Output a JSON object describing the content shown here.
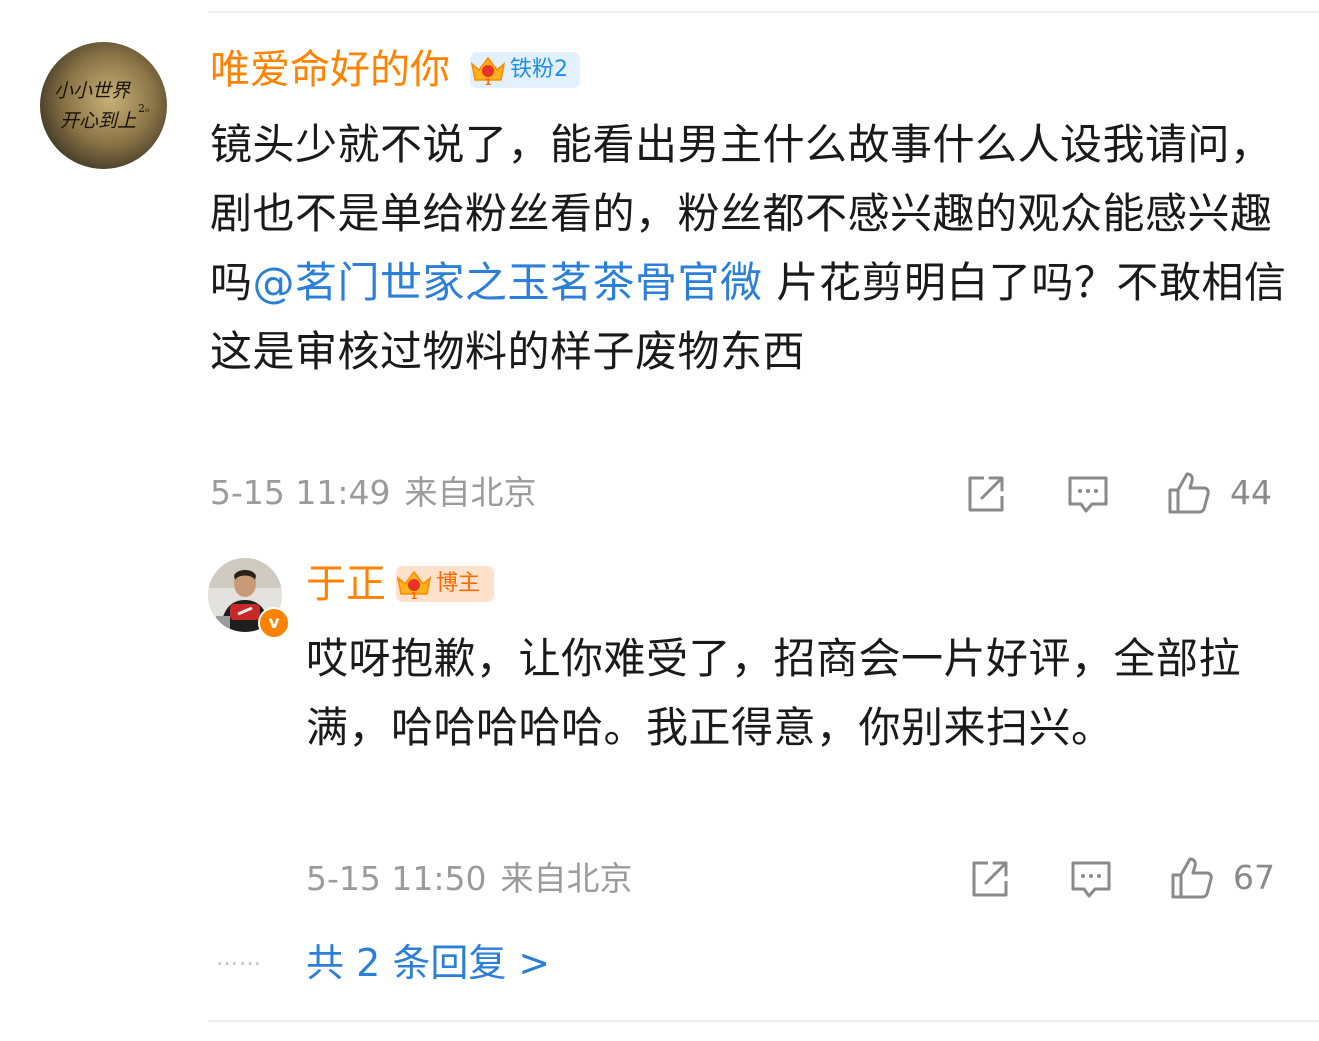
{
  "main_comment": {
    "username": "唯爱命好的你",
    "badge_label": "铁粉2",
    "badge_level": "1",
    "text_before_mention": "镜头少就不说了，能看出男主什么故事什么人设我请问，剧也不是单给粉丝看的，粉丝都不感兴趣的观众能感兴趣吗",
    "mention": "@茗门世家之玉茗茶骨官微",
    "text_after_mention": " 片花剪明白了吗？不敢相信这是审核过物料的样子废物东西",
    "time": "5-15 11:49",
    "location": "来自北京",
    "like_count": "44",
    "avatar_text_line1": "小小世界",
    "avatar_text_line2": "开心到上",
    "avatar_text_small": "2ₒ"
  },
  "reply": {
    "username": "于正",
    "badge_label": "博主",
    "badge_level": "1",
    "verified_mark": "v",
    "text": "哎呀抱歉，让你难受了，招商会一片好评，全部拉满，哈哈哈哈哈。我正得意，你别来扫兴。",
    "time": "5-15 11:50",
    "location": "来自北京",
    "like_count": "67"
  },
  "more_dots": "……",
  "more_replies_label": "共 2 条回复 >",
  "icons": {
    "share": "share-icon",
    "comment": "comment-icon",
    "like": "thumbs-up-icon",
    "fan_badge": "crown-icon",
    "verified": "verified-badge-icon"
  },
  "colors": {
    "username": "#ff8200",
    "link": "#2c7fd8",
    "meta": "#9b9b9b",
    "fan_badge_bg": "#e2f0ff",
    "fan_badge_text": "#1f8fe5",
    "blogger_badge_bg": "#ffe1cc",
    "blogger_badge_text": "#ff6a00"
  }
}
